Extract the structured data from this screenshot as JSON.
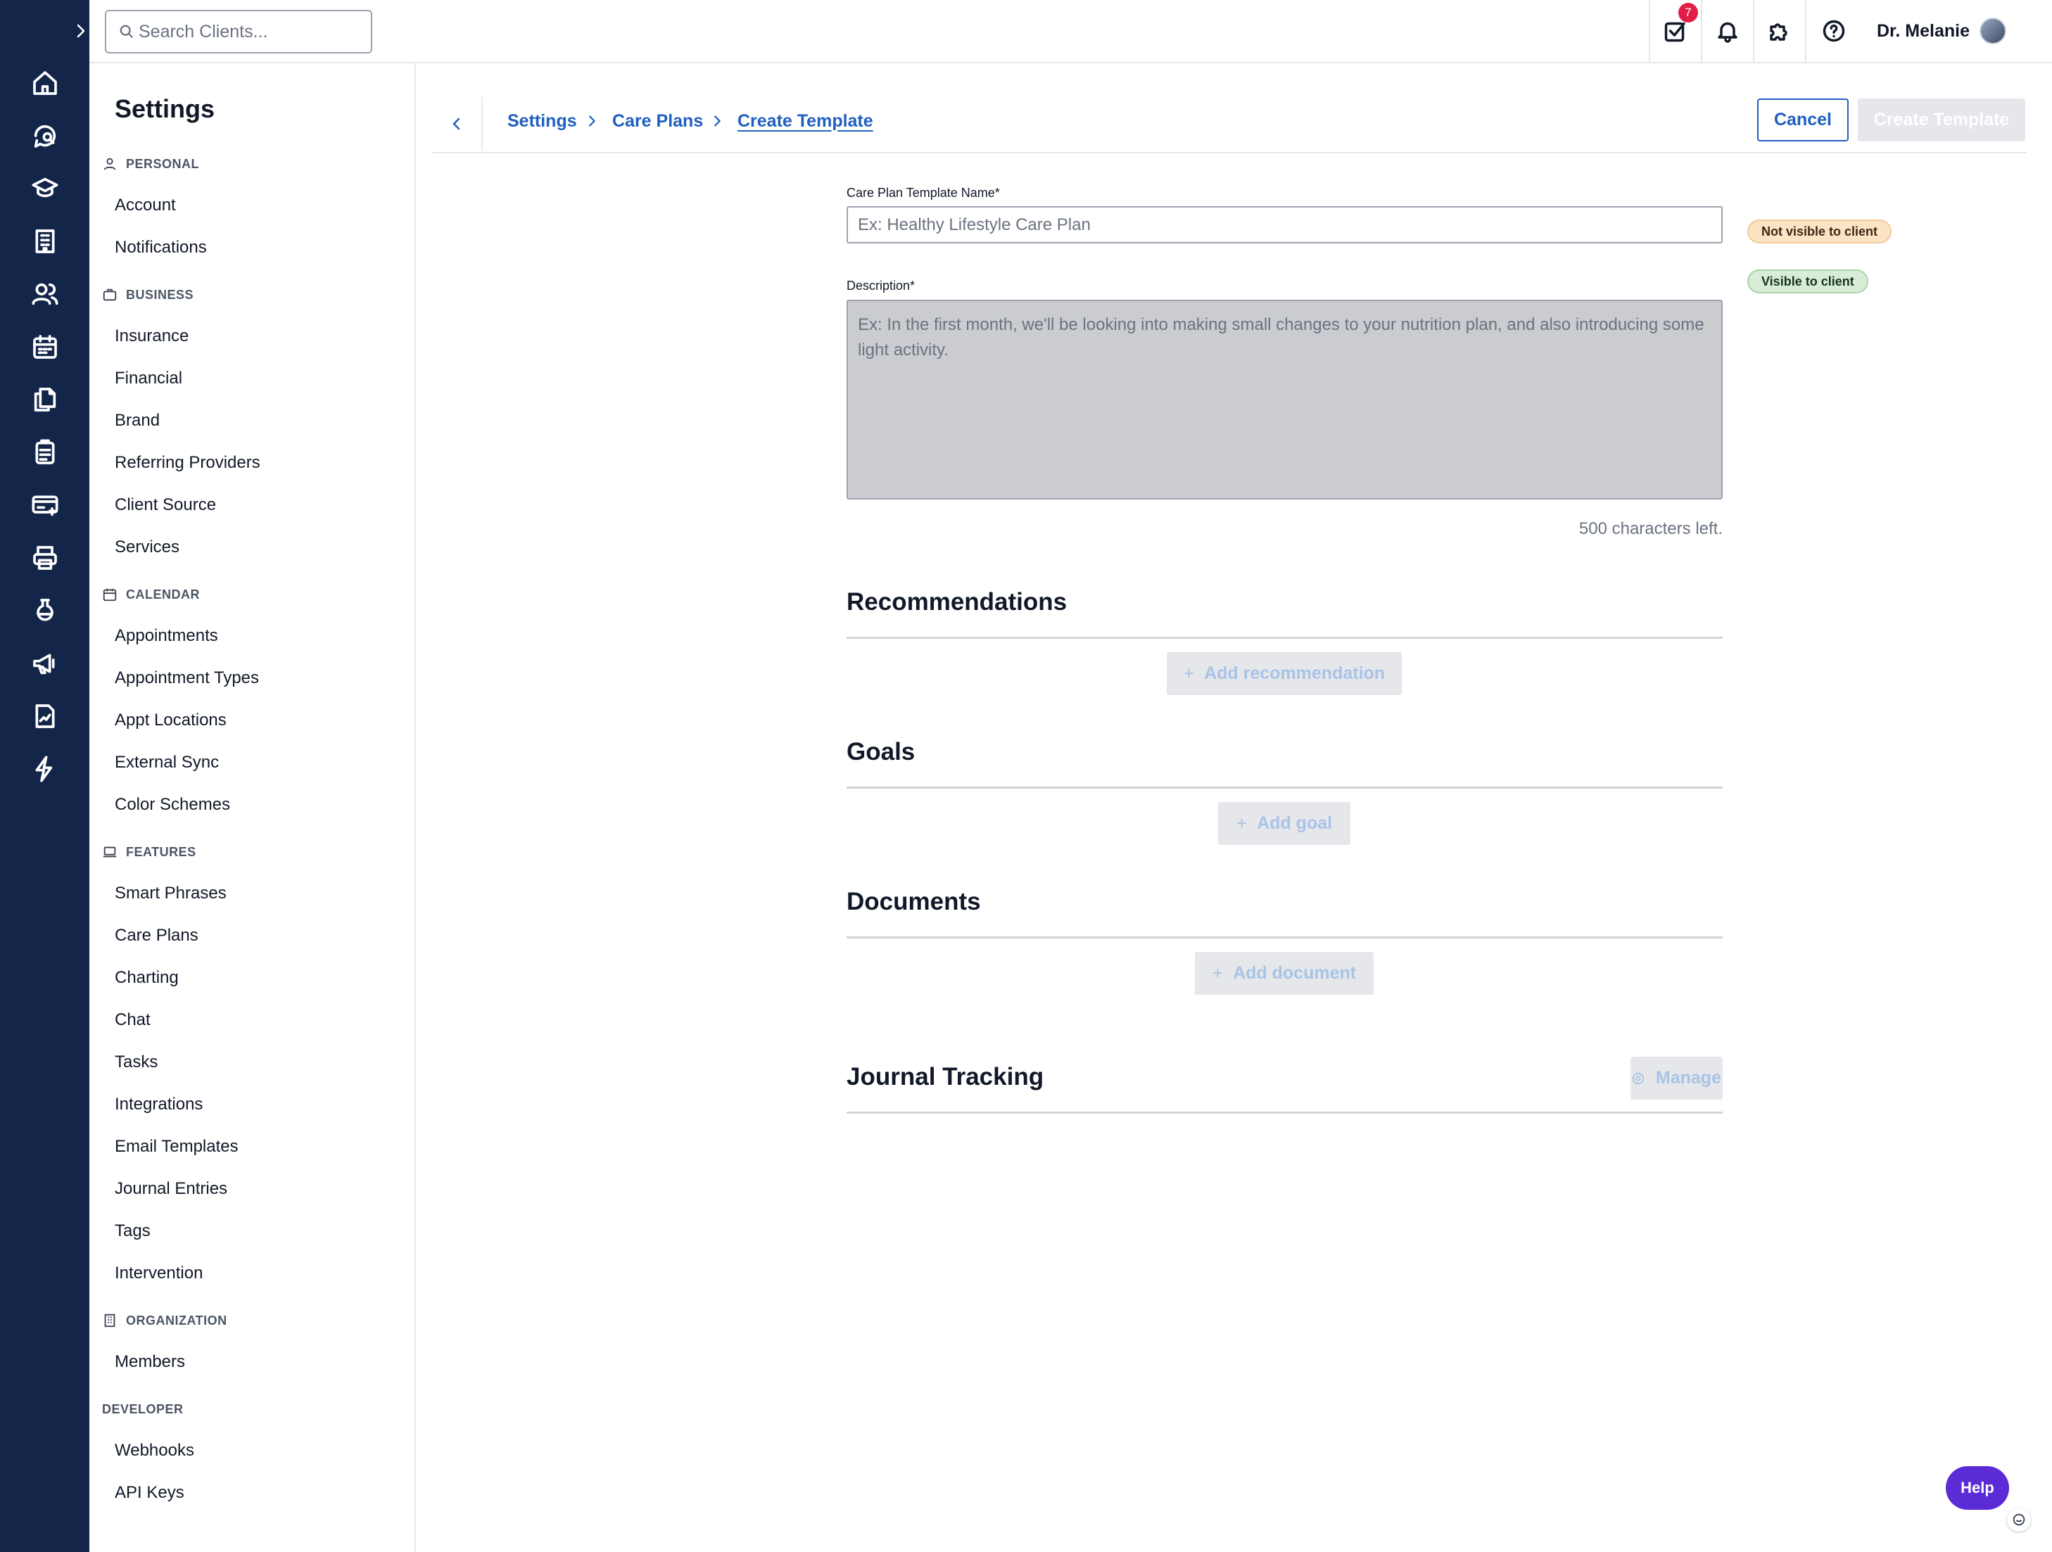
{
  "search": {
    "placeholder": "Search Clients..."
  },
  "topbar": {
    "task_badge": "7",
    "user_name": "Dr. Melanie"
  },
  "sidebar": {
    "title": "Settings",
    "sections": {
      "personal": "PERSONAL",
      "business": "BUSINESS",
      "calendar": "CALENDAR",
      "features": "FEATURES",
      "organization": "ORGANIZATION",
      "developer": "DEVELOPER"
    },
    "items": {
      "account": "Account",
      "notifications": "Notifications",
      "insurance": "Insurance",
      "financial": "Financial",
      "brand": "Brand",
      "referring_providers": "Referring Providers",
      "client_source": "Client Source",
      "services": "Services",
      "appointments": "Appointments",
      "appointment_types": "Appointment Types",
      "appt_locations": "Appt Locations",
      "external_sync": "External Sync",
      "color_schemes": "Color Schemes",
      "smart_phrases": "Smart Phrases",
      "care_plans": "Care Plans",
      "charting": "Charting",
      "chat": "Chat",
      "tasks": "Tasks",
      "integrations": "Integrations",
      "email_templates": "Email Templates",
      "journal_entries": "Journal Entries",
      "tags": "Tags",
      "intervention": "Intervention",
      "members": "Members",
      "webhooks": "Webhooks",
      "api_keys": "API Keys"
    }
  },
  "breadcrumb": {
    "settings": "Settings",
    "care_plans": "Care Plans",
    "current": "Create Template"
  },
  "actions": {
    "cancel": "Cancel",
    "create": "Create Template"
  },
  "form": {
    "name_label": "Care Plan Template Name*",
    "name_placeholder": "Ex: Healthy Lifestyle Care Plan",
    "name_value": "",
    "description_label": "Description*",
    "description_placeholder": "Ex: In the first month, we'll be looking into making small changes to your nutrition plan, and also introducing some light activity.",
    "description_value": "",
    "chars_left": "500 characters left.",
    "not_visible_pill": "Not visible to client",
    "visible_pill": "Visible to client"
  },
  "sections": {
    "recommendations": {
      "title": "Recommendations",
      "add_label": "Add recommendation"
    },
    "goals": {
      "title": "Goals",
      "add_label": "Add goal"
    },
    "documents": {
      "title": "Documents",
      "add_label": "Add document"
    },
    "journal": {
      "title": "Journal Tracking",
      "manage_label": "Manage"
    }
  },
  "help": {
    "label": "Help"
  },
  "colors": {
    "rail": "#14254a",
    "accent": "#1f5fbf",
    "help": "#5b2bd6",
    "badge": "#e11d48"
  }
}
